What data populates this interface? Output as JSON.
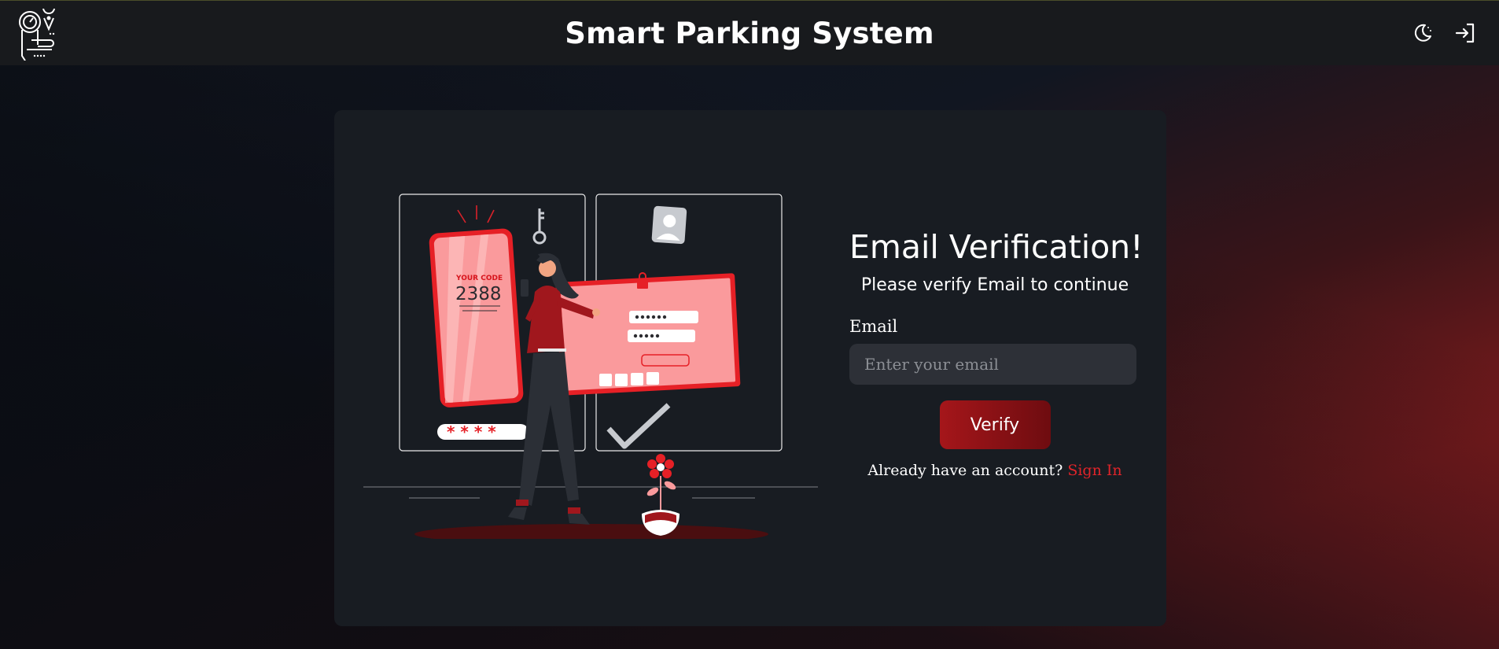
{
  "header": {
    "title": "Smart Parking System",
    "logo_icon": "parking-pin-logo-icon",
    "theme_icon": "moon-icon",
    "login_icon": "sign-in-icon"
  },
  "illustration": {
    "phone_code_label": "YOUR CODE",
    "phone_code": "2388",
    "pin_mask": "* * * *"
  },
  "form": {
    "heading": "Email Verification!",
    "subheading": "Please verify Email to continue",
    "email_label": "Email",
    "email_placeholder": "Enter your email",
    "email_value": "",
    "verify_label": "Verify",
    "account_prompt": "Already have an account?",
    "signin_label": "Sign In"
  },
  "colors": {
    "accent": "#e0242a",
    "button_start": "#a5161a",
    "button_end": "#6e0c10",
    "card": "#181c22",
    "header": "#181a1d"
  }
}
